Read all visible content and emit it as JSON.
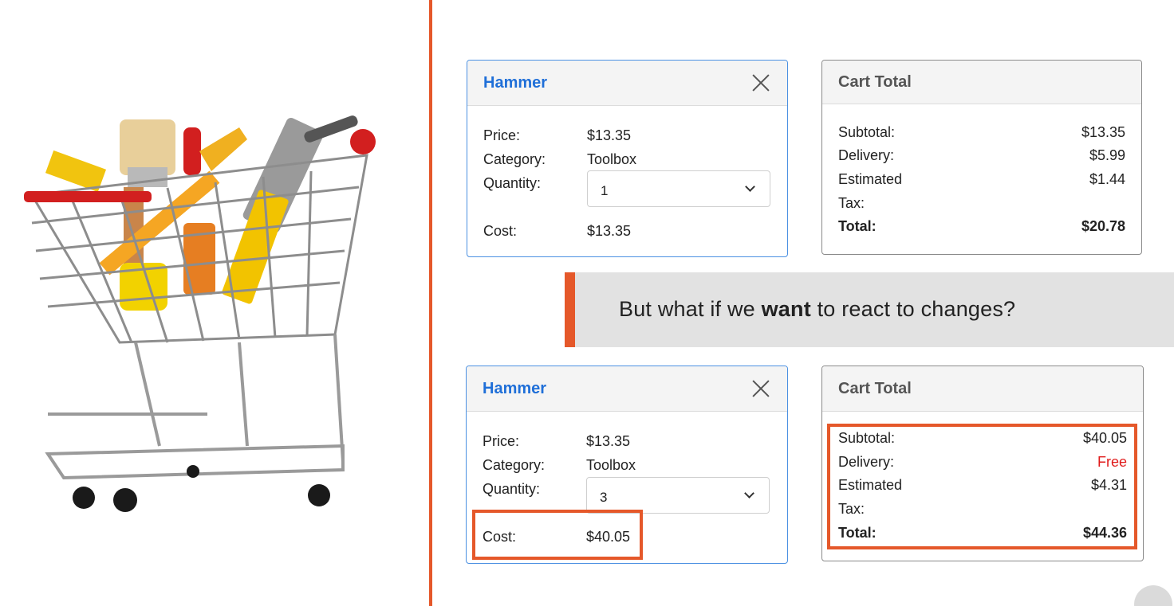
{
  "colors": {
    "accent": "#e5582a",
    "link_blue": "#1f6fd8",
    "free_red": "#e01b1b"
  },
  "illustration": {
    "icon": "shopping-cart-with-tools"
  },
  "before": {
    "item_card": {
      "title": "Hammer",
      "price_label": "Price:",
      "price": "$13.35",
      "category_label": "Category:",
      "category": "Toolbox",
      "quantity_label": "Quantity:",
      "quantity": "1",
      "cost_label": "Cost:",
      "cost": "$13.35"
    },
    "total_card": {
      "title": "Cart Total",
      "subtotal_label": "Subtotal:",
      "subtotal": "$13.35",
      "delivery_label": "Delivery:",
      "delivery": "$5.99",
      "tax_label_1": "Estimated",
      "tax_label_2": "Tax:",
      "tax": "$1.44",
      "total_label": "Total:",
      "total": "$20.78"
    }
  },
  "banner": {
    "prefix": "But what if we ",
    "emphasis": "want",
    "suffix": " to react to changes?"
  },
  "after": {
    "item_card": {
      "title": "Hammer",
      "price_label": "Price:",
      "price": "$13.35",
      "category_label": "Category:",
      "category": "Toolbox",
      "quantity_label": "Quantity:",
      "quantity": "3",
      "cost_label": "Cost:",
      "cost": "$40.05"
    },
    "total_card": {
      "title": "Cart Total",
      "subtotal_label": "Subtotal:",
      "subtotal": "$40.05",
      "delivery_label": "Delivery:",
      "delivery": "Free",
      "tax_label_1": "Estimated",
      "tax_label_2": "Tax:",
      "tax": "$4.31",
      "total_label": "Total:",
      "total": "$44.36"
    }
  }
}
